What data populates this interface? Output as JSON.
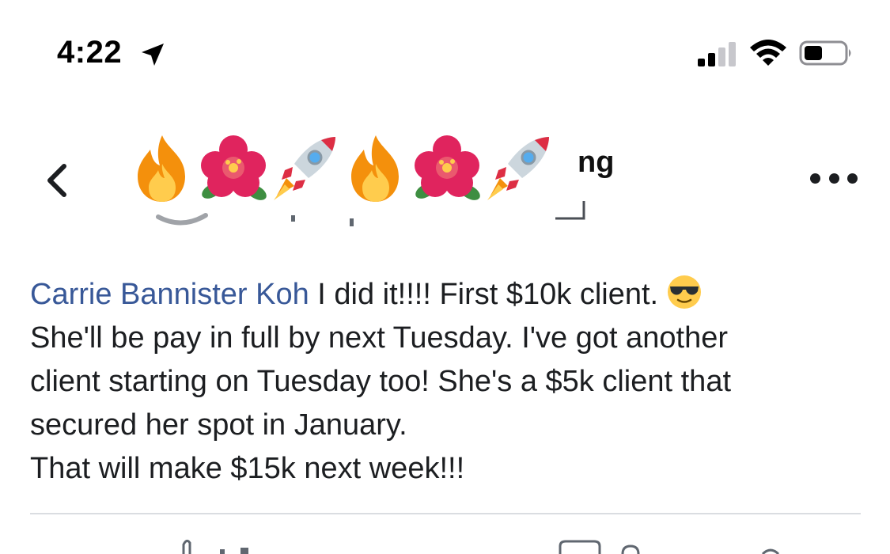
{
  "status_bar": {
    "time": "4:22",
    "icons": [
      "location-arrow-icon",
      "cellular-signal-icon",
      "wifi-icon",
      "battery-icon"
    ]
  },
  "header": {
    "back_icon": "chevron-left-icon",
    "title_emojis": [
      "fire",
      "hibiscus",
      "rocket",
      "fire",
      "hibiscus",
      "rocket"
    ],
    "title_visible_fragment": "ng",
    "more_icon": "more-dots-icon"
  },
  "post": {
    "author": "Carrie Bannister Koh",
    "line1": " I did it!!!!  First $10k client.",
    "line1_emoji": "smiling-face-with-sunglasses",
    "line2": "She'll be pay in full by next Tuesday. I've got another",
    "line3": "client starting on Tuesday too!  She's a $5k client that",
    "line4": "secured her spot in January.",
    "line5": "That will make $15k next week!!!"
  },
  "colors": {
    "author_link": "#385898",
    "text": "#1c1e21",
    "divider": "#dadde1"
  }
}
